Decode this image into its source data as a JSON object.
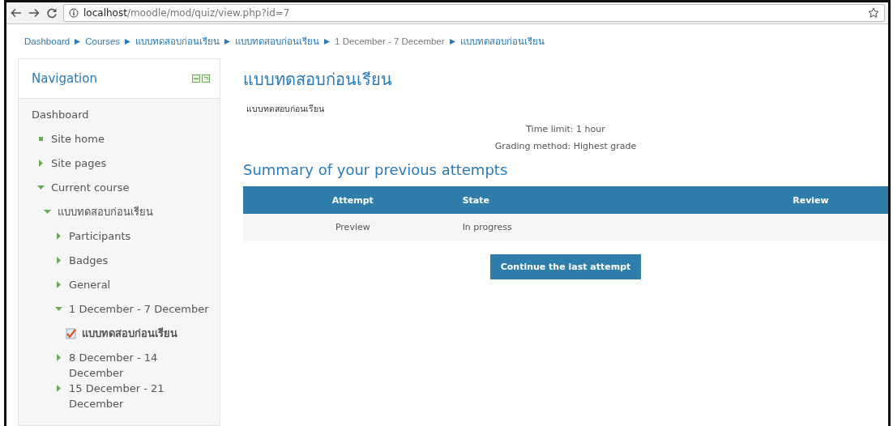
{
  "browser": {
    "url_host": "localhost",
    "url_path": "/moodle/mod/quiz/view.php?id=7"
  },
  "breadcrumb": [
    {
      "label": "Dashboard",
      "link": true
    },
    {
      "label": "Courses",
      "link": true
    },
    {
      "label": "แบบทดสอบก่อนเรียน",
      "link": true
    },
    {
      "label": "แบบทดสอบก่อนเรียน",
      "link": true
    },
    {
      "label": "1 December - 7 December",
      "link": false
    },
    {
      "label": "แบบทดสอบก่อนเรียน",
      "link": true
    }
  ],
  "navigation": {
    "title": "Navigation",
    "items": [
      {
        "label": "Dashboard",
        "kind": "plain"
      },
      {
        "label": "Site home",
        "kind": "leaf"
      },
      {
        "label": "Site pages",
        "kind": "branch",
        "expanded": false
      },
      {
        "label": "Current course",
        "kind": "branch",
        "expanded": true,
        "children": [
          {
            "label": "แบบทดสอบก่อนเรียน",
            "kind": "branch",
            "expanded": true,
            "children": [
              {
                "label": "Participants",
                "kind": "branch",
                "expanded": false
              },
              {
                "label": "Badges",
                "kind": "branch",
                "expanded": false
              },
              {
                "label": "General",
                "kind": "branch",
                "expanded": false
              },
              {
                "label": "1 December - 7 December",
                "kind": "branch",
                "expanded": true,
                "children": [
                  {
                    "label": "แบบทดสอบก่อนเรียน",
                    "kind": "quiz"
                  }
                ]
              },
              {
                "label": "8 December - 14 December",
                "kind": "branch",
                "expanded": false
              },
              {
                "label": "15 December - 21 December",
                "kind": "branch",
                "expanded": false
              }
            ]
          }
        ]
      }
    ]
  },
  "main": {
    "title": "แบบทดสอบก่อนเรียน",
    "intro": "แบบทดสอบก่อนเรียน",
    "info": [
      "Time limit: 1 hour",
      "Grading method: Highest grade"
    ],
    "summary_title": "Summary of your previous attempts",
    "table": {
      "columns": [
        "Attempt",
        "State",
        "Review"
      ],
      "rows": [
        [
          "Preview",
          "In progress",
          ""
        ]
      ]
    },
    "button": "Continue the last attempt"
  }
}
